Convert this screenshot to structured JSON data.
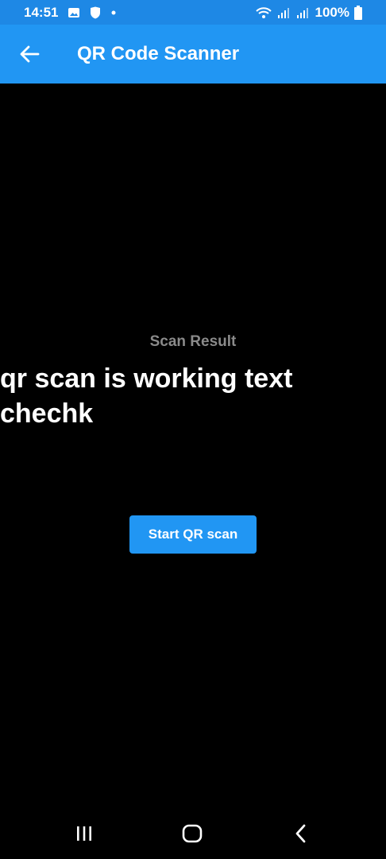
{
  "status_bar": {
    "time": "14:51",
    "battery_text": "100%",
    "icons": [
      "image-icon",
      "shield-icon",
      "dot-icon",
      "wifi-icon",
      "signal-icon",
      "signal-icon",
      "battery-icon"
    ]
  },
  "app_bar": {
    "title": "QR Code Scanner",
    "back_icon": "arrow-back-icon"
  },
  "main": {
    "label": "Scan Result",
    "result_text": "qr scan is working text chechk",
    "button_label": "Start QR scan"
  },
  "nav_bar": {
    "icons": [
      "recents-icon",
      "home-icon",
      "back-icon"
    ]
  },
  "colors": {
    "status_bar": "#1e88e5",
    "app_bar": "#2196f3",
    "background": "#000000",
    "button": "#2196f3",
    "label": "#8a8a8a"
  }
}
